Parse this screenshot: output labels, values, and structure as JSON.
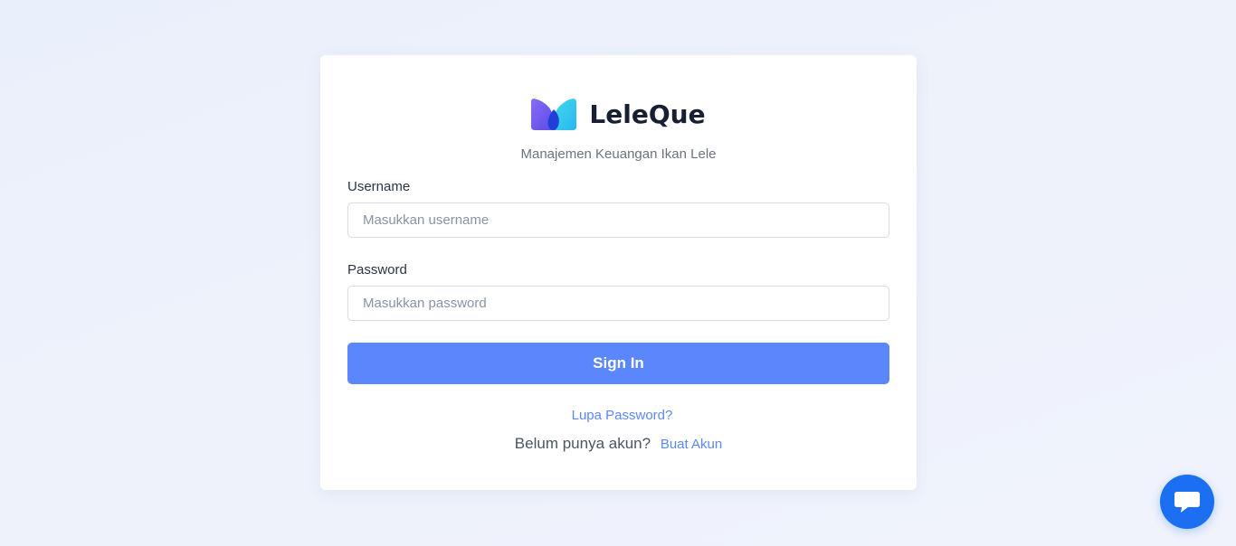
{
  "brand": {
    "name": "LeleQue",
    "tagline": "Manajemen Keuangan Ikan Lele",
    "logo_icon": "leleque-logo-icon"
  },
  "form": {
    "username_label": "Username",
    "username_placeholder": "Masukkan username",
    "username_value": "",
    "password_label": "Password",
    "password_placeholder": "Masukkan password",
    "password_value": "",
    "submit_label": "Sign In"
  },
  "links": {
    "forgot_password": "Lupa Password?",
    "no_account_text": "Belum punya akun?",
    "create_account": "Buat Akun"
  },
  "chat_widget": {
    "icon": "chat-bubble-icon"
  },
  "colors": {
    "primary": "#5b87fc",
    "chat_widget": "#1b6ff0",
    "background": "#ecf1fb"
  }
}
